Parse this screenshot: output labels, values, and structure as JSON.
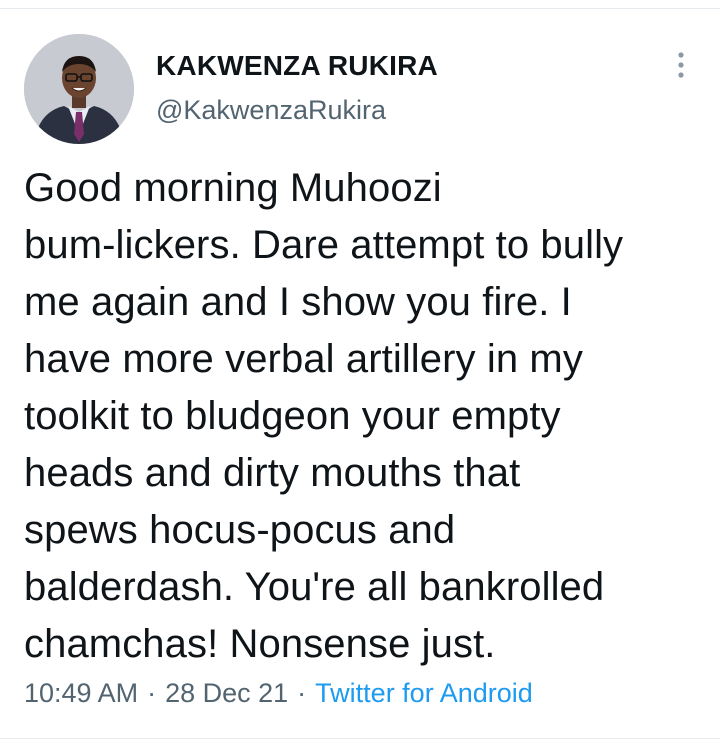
{
  "tweet": {
    "author": {
      "display_name": "KAKWENZA RUKIRA",
      "handle": "@KakwenzaRukira",
      "avatar_icon": "profile-photo"
    },
    "more_icon": "vertical-ellipsis-icon",
    "text": "Good morning Muhoozi\nbum-lickers. Dare attempt to bully\nme again and I show you fire. I\nhave more verbal artillery in my\ntoolkit to bludgeon your empty\nheads and dirty mouths that\nspews hocus-pocus and\nbalderdash. You're all bankrolled\nchamchas! Nonsense just.",
    "time": "10:49 AM",
    "separator": "·",
    "date": "28 Dec 21",
    "source": "Twitter for Android"
  },
  "colors": {
    "text_primary": "#0f1419",
    "text_secondary": "#536471",
    "link": "#1d9bf0",
    "divider": "#e6ecf0"
  }
}
